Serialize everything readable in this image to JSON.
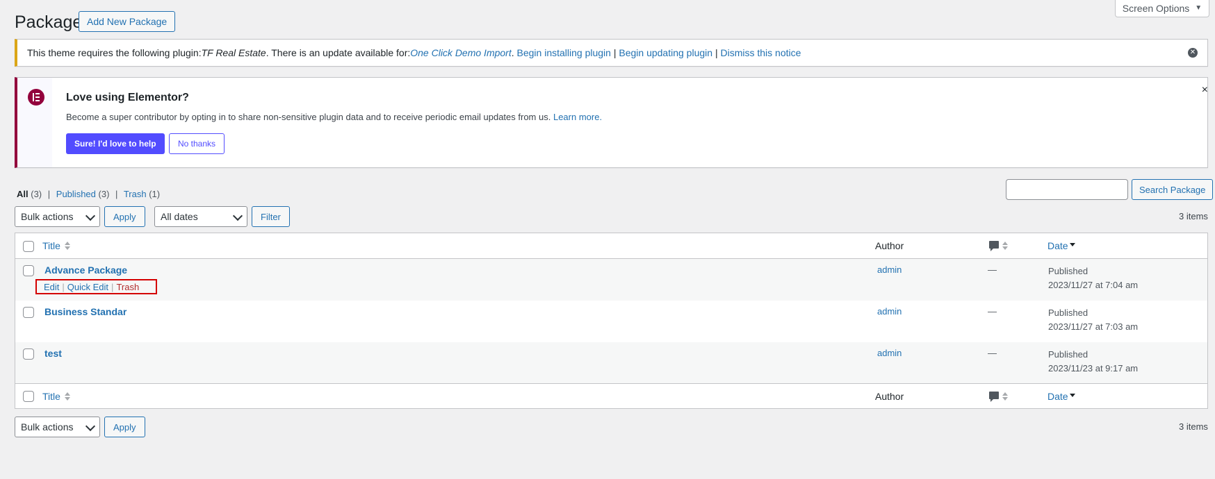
{
  "header": {
    "title": "Package",
    "add_new_label": "Add New Package",
    "screen_options_label": "Screen Options"
  },
  "plugin_notice": {
    "text_before": "This theme requires the following plugin: ",
    "plugin_name": "TF Real Estate",
    "text_middle": ". There is an update available for: ",
    "update_plugin": "One Click Demo Import",
    "period": ".",
    "link_install": "Begin installing plugin",
    "separator": "|",
    "link_update": "Begin updating plugin",
    "link_dismiss": "Dismiss this notice"
  },
  "elementor_notice": {
    "title": "Love using Elementor?",
    "text": "Become a super contributor by opting in to share non-sensitive plugin data and to receive periodic email updates from us.",
    "learn_more": "Learn more.",
    "yes_label": "Sure! I'd love to help",
    "no_label": "No thanks",
    "close": "×"
  },
  "views": {
    "all_label": "All",
    "all_count": "(3)",
    "published_label": "Published",
    "published_count": "(3)",
    "trash_label": "Trash",
    "trash_count": "(1)",
    "separator": "|"
  },
  "search": {
    "button_label": "Search Package",
    "value": ""
  },
  "top_nav": {
    "bulk_actions": "Bulk actions",
    "apply": "Apply",
    "dates": "All dates",
    "filter": "Filter",
    "items": "3 items"
  },
  "bottom_nav": {
    "bulk_actions": "Bulk actions",
    "apply": "Apply",
    "items": "3 items"
  },
  "table": {
    "columns": {
      "title": "Title",
      "author": "Author",
      "date": "Date"
    },
    "rows": [
      {
        "title": "Advance Package",
        "author": "admin",
        "comments": "—",
        "status": "Published",
        "date": "2023/11/27 at 7:04 am",
        "actions": {
          "edit": "Edit",
          "quick_edit": "Quick Edit",
          "trash": "Trash",
          "sep": "|"
        }
      },
      {
        "title": "Business Standar",
        "author": "admin",
        "comments": "—",
        "status": "Published",
        "date": "2023/11/27 at 7:03 am"
      },
      {
        "title": "test",
        "author": "admin",
        "comments": "—",
        "status": "Published",
        "date": "2023/11/23 at 9:17 am"
      }
    ]
  },
  "colors": {
    "link": "#2271b1",
    "warning_border": "#dba617",
    "elementor_brand": "#93003c",
    "elementor_button": "#524cff",
    "highlight_box": "#d40000",
    "trash": "#b32d2e"
  }
}
